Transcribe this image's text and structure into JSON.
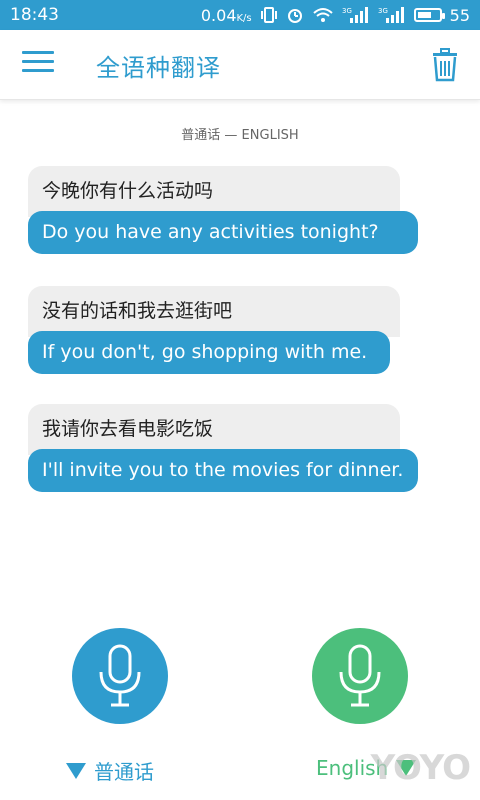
{
  "status_bar": {
    "time": "18:43",
    "network_speed": "0.04",
    "speed_unit": "K/s",
    "battery": "55",
    "signal_1_label": "3G",
    "signal_2_label": "3G"
  },
  "app_bar": {
    "title": "全语种翻译"
  },
  "language_pair_caption": "普通话 — ENGLISH",
  "conversation": [
    {
      "source": "今晚你有什么活动吗",
      "translation": "Do you have any activities tonight?"
    },
    {
      "source": "没有的话和我去逛街吧",
      "translation": "If you don't, go shopping with me."
    },
    {
      "source": "我请你去看电影吃饭",
      "translation": "I'll invite you to the movies for dinner."
    }
  ],
  "bottom": {
    "left_language": "普通话",
    "right_language": "English",
    "left_color": "#2f9cce",
    "right_color": "#4cbf7c"
  },
  "watermark": "YOYO"
}
